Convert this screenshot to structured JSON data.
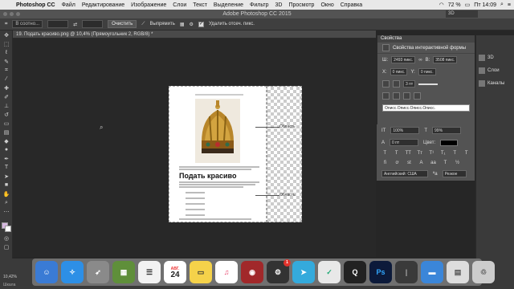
{
  "menubar": {
    "app_name": "Photoshop CC",
    "items": [
      "Файл",
      "Редактирование",
      "Изображение",
      "Слои",
      "Текст",
      "Выделение",
      "Фильтр",
      "3D",
      "Просмотр",
      "Окно",
      "Справка"
    ],
    "battery": "72 %",
    "time": "Пт 14:09"
  },
  "window": {
    "title": "Adobe Photoshop CC 2015",
    "workspace": "3D"
  },
  "options": {
    "preset": "В соотно...",
    "clear_label": "Очистить",
    "straighten_label": "Выпрямить",
    "delete_crop_label": "Удалить отсеч. пикс."
  },
  "document": {
    "tab_title": "19. Подать красиво.png @ 10,4% (Прямоугольник 2, RGB/8) *",
    "heading": "Подать красиво",
    "callout_1": "Область",
    "callout_2": "Область"
  },
  "properties": {
    "tab_label": "Свойства",
    "subtitle": "Свойства интерактивной формы",
    "w_label": "Ш:",
    "w_value": "2493 пикс.",
    "h_label": "В:",
    "h_value": "3508 пикс.",
    "x_label": "X:",
    "x_value": "0 пикс.",
    "y_label": "Y:",
    "y_value": "0 пикс.",
    "stroke_value": "3 пт",
    "text_field": "Описс.Описс.Описс.Описс."
  },
  "character": {
    "tracking_value": "100%",
    "vscale_value": "99%",
    "baseline_value": "0 пт",
    "color_label": "Цвет:",
    "language": "Английский: США",
    "aa": "Резкое"
  },
  "right_panel": {
    "items": [
      "3D",
      "Слои",
      "Каналы"
    ]
  },
  "status": {
    "zoom": "10,42%",
    "mini_bridge": "Шкала"
  },
  "dock": {
    "calendar_month": "АВГ.",
    "calendar_day": "24",
    "badge_count": "1"
  }
}
